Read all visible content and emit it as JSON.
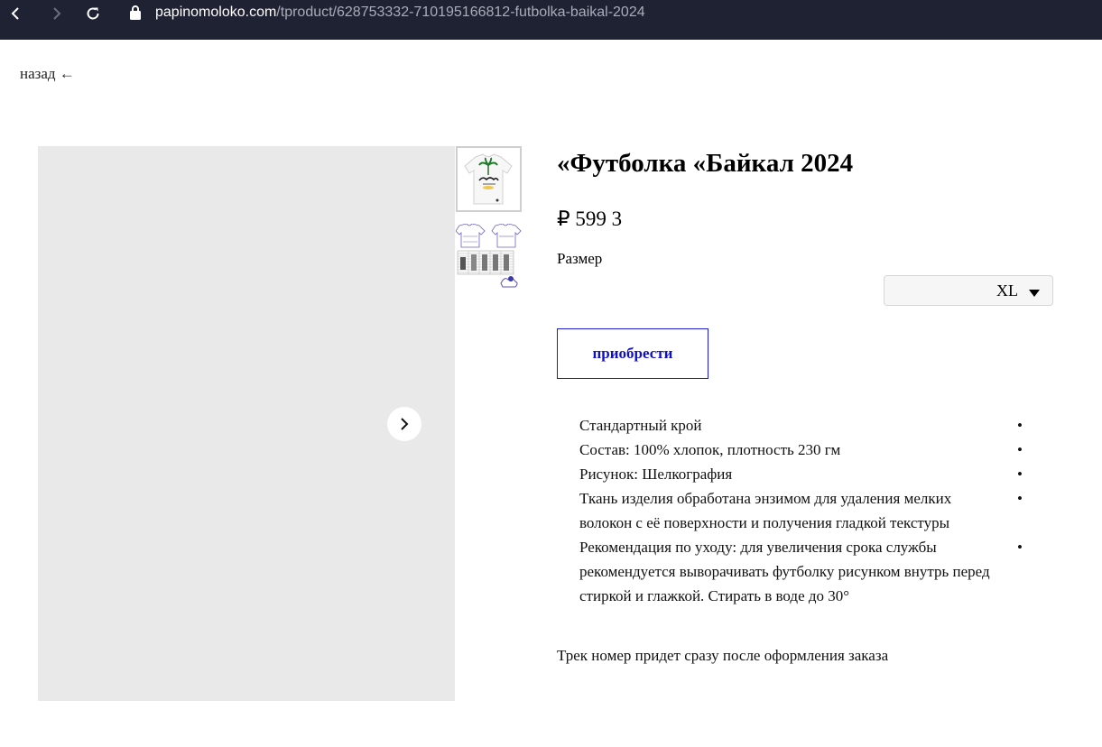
{
  "browser": {
    "url_host": "papinomoloko.com",
    "url_path": "/tproduct/628753332-710195166812-futbolka-baikal-2024"
  },
  "page": {
    "back_label": "назад ←",
    "product": {
      "title": "«Футболка «Байкал 2024",
      "price": "₽ 599 3",
      "size_label": "Размер",
      "size_value": "XL",
      "buy_label": "приобрести",
      "features": [
        "Стандартный крой",
        "Состав: 100% хлопок, плотность 230 гм",
        "Рисунок: Шелкография",
        "Ткань изделия обработана энзимом для удаления мелких волокон с её поверхности и получения гладкой текстуры",
        "Рекомендация по уходу: для увеличения срока службы рекомендуется выворачивать футболку рисунком внутрь перед стиркой и глажкой. Стирать в воде до 30°"
      ],
      "bullet": "•",
      "delivery_note": "Трек номер придет сразу после оформления заказа"
    }
  },
  "icons": {
    "back": "chevron-left-icon",
    "forward": "chevron-right-icon",
    "reload": "reload-icon",
    "lock": "lock-icon",
    "gallery_next": "chevron-right-icon"
  },
  "colors": {
    "chrome": "#1f2233",
    "buy_accent": "#1a1ad6",
    "gallery_bg": "#e9e9e9"
  }
}
